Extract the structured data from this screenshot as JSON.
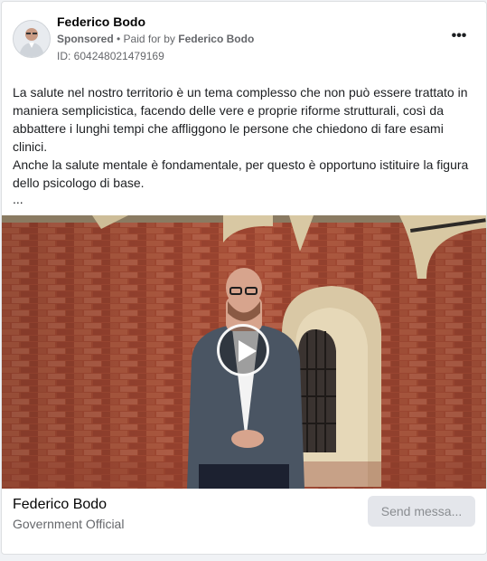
{
  "post": {
    "author_name": "Federico Bodo",
    "sponsored_label": "Sponsored",
    "separator": " • ",
    "paid_for_by": "Paid for by",
    "paid_for_name": "Federico Bodo",
    "ad_id_label": "ID: 604248021479169",
    "more_options": "•••",
    "text_paragraph_1": "La salute nel nostro territorio è un tema complesso che non può essere trattato in maniera semplicistica, facendo delle vere e proprie riforme strutturali, così da abbattere i lunghi tempi che affliggono le persone che chiedono di fare esami clinici.",
    "text_paragraph_2": "Anche la salute mentale è fondamentale, per questo è opportuno istituire la figura dello psicologo di base.",
    "see_more": "..."
  },
  "media": {
    "type": "video",
    "play_icon": "play-icon"
  },
  "footer": {
    "page_name": "Federico Bodo",
    "page_category": "Government Official",
    "cta_label": "Send messa..."
  },
  "colors": {
    "brick": "#a14a34",
    "stone": "#d9c8a5",
    "text_primary": "#050505",
    "text_secondary": "#65676b",
    "button_bg": "#e4e6eb"
  }
}
